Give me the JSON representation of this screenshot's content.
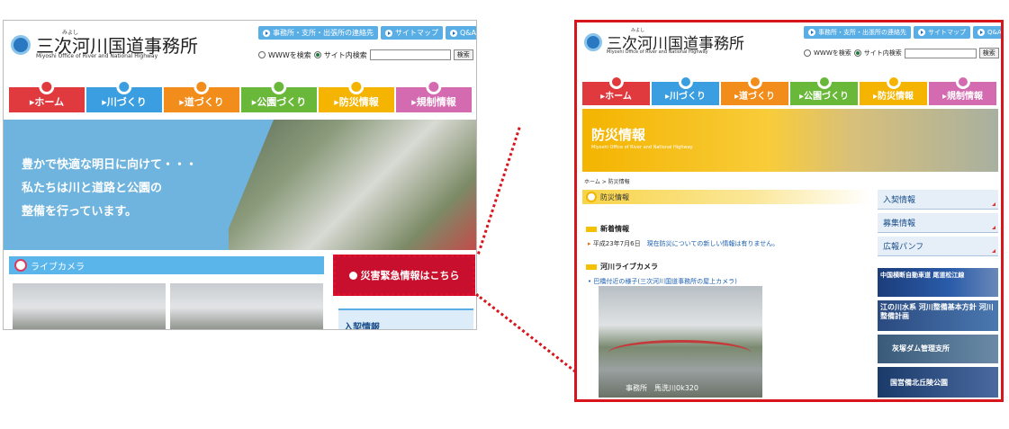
{
  "left_page": {
    "org_name": "三次河川国道事務所",
    "org_ruby": "みよし",
    "org_sub": "Miyoshi Office of River and National Highway",
    "top_links": [
      "事務所・支所・出張所の連絡先",
      "サイトマップ",
      "Q&A"
    ],
    "search": {
      "opt1": "WWWを検索",
      "opt2": "サイト内検索",
      "button": "検索"
    },
    "nav": [
      {
        "label": "ホーム",
        "color": "#e0393e"
      },
      {
        "label": "川づくり",
        "color": "#3a9ee0"
      },
      {
        "label": "道づくり",
        "color": "#f28c1a"
      },
      {
        "label": "公園づくり",
        "color": "#6ab83a"
      },
      {
        "label": "防災情報",
        "color": "#f5b400"
      },
      {
        "label": "規制情報",
        "color": "#d46bb0"
      }
    ],
    "hero_lines": [
      "豊かで快適な明日に向けて・・・",
      "私たちは川と道路と公園の",
      "整備を行っています。"
    ],
    "livecam_label": "ライブカメラ",
    "disaster_button": "災害緊急情報はこちら",
    "sidebar_label": "入契情報"
  },
  "right_page": {
    "org_name": "三次河川国道事務所",
    "org_ruby": "みよし",
    "org_sub": "Miyoshi Office of River and National Highway",
    "top_links": [
      "事務所・支所・出張所の連絡先",
      "サイトマップ",
      "Q&A"
    ],
    "search": {
      "opt1": "WWWを検索",
      "opt2": "サイト内検索",
      "button": "検索"
    },
    "nav": [
      {
        "label": "ホーム",
        "color": "#e0393e"
      },
      {
        "label": "川づくり",
        "color": "#3a9ee0"
      },
      {
        "label": "道づくり",
        "color": "#f28c1a"
      },
      {
        "label": "公園づくり",
        "color": "#6ab83a"
      },
      {
        "label": "防災情報",
        "color": "#f5b400"
      },
      {
        "label": "規制情報",
        "color": "#d46bb0"
      }
    ],
    "banner_title": "防災情報",
    "banner_sub": "Miyoshi Office of River and National Highway",
    "breadcrumb": "ホーム > 防災情報",
    "section_title": "防災情報",
    "news_heading": "新着情報",
    "news_date": "平成23年7月6日",
    "news_text": "現在防災についての新しい情報は有りません。",
    "cam_heading": "河川ライブカメラ",
    "cam_link": "巴橋付近の様子(三次河川国道事務所の屋上カメラ)",
    "cam_caption": "事務所　馬洗川0k320",
    "side_buttons": [
      "入契情報",
      "募集情報",
      "広報パンフ"
    ],
    "side_banners": [
      "中国横断自動車道 尾道松江線",
      "江の川水系 河川整備基本方針 河川整備計画",
      "灰塚ダム管理支所",
      "国営備北丘陵公園"
    ]
  },
  "colors": {
    "highlight": "#d8141c",
    "accent": "#5aaee6"
  }
}
